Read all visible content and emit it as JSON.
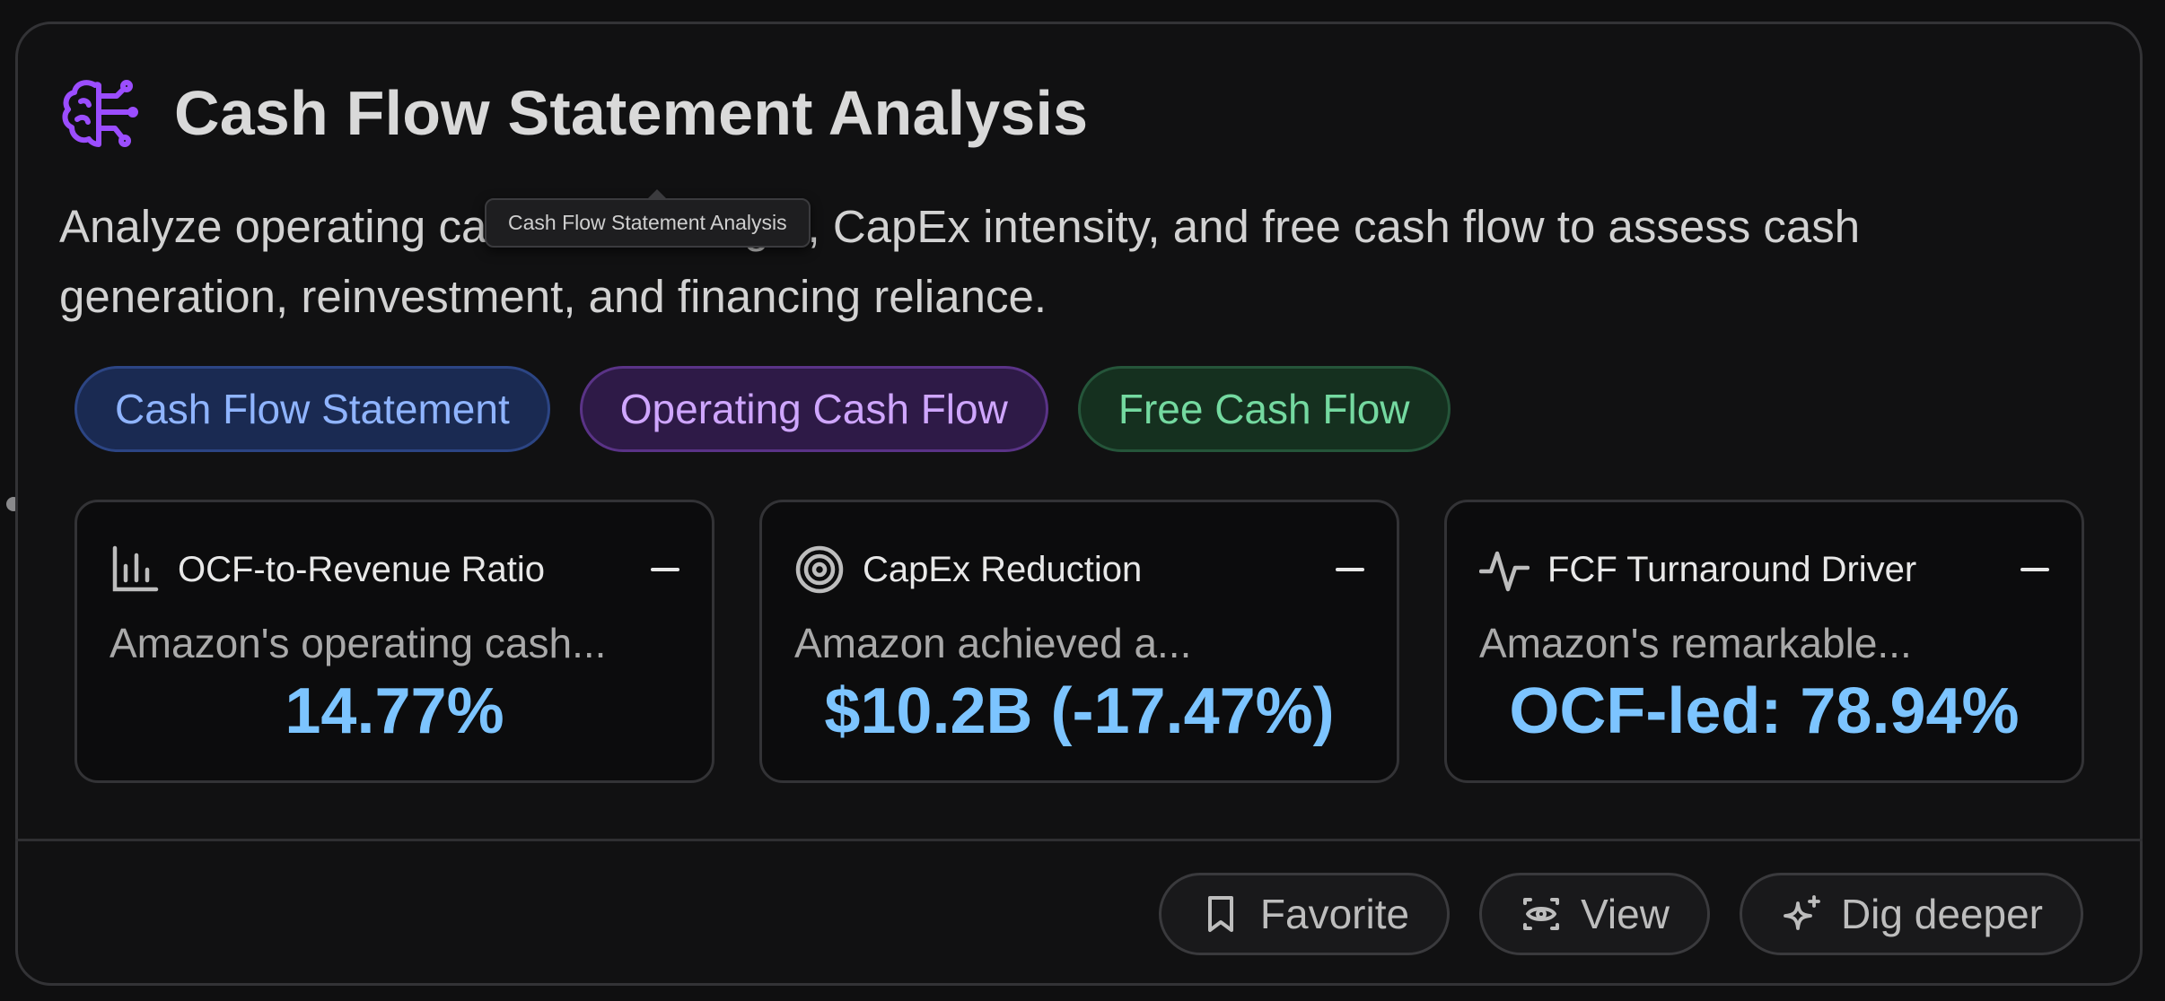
{
  "card": {
    "title": "Cash Flow Statement Analysis",
    "title_icon": "brain-icon",
    "description": "Analyze operating cash flow strength, CapEx intensity, and free cash flow to assess cash generation, reinvestment, and financing reliance.",
    "tooltip": "Cash Flow Statement Analysis"
  },
  "tags": [
    {
      "label": "Cash Flow Statement",
      "color": "#8fb4ff"
    },
    {
      "label": "Operating Cash Flow",
      "color": "#cfa6ff"
    },
    {
      "label": "Free Cash Flow",
      "color": "#74d9a0"
    }
  ],
  "metrics": [
    {
      "icon": "bar-chart-icon",
      "label": "OCF-to-Revenue Ratio",
      "description": "Amazon's operating cash...",
      "value": "14.77%"
    },
    {
      "icon": "target-icon",
      "label": "CapEx Reduction",
      "description": "Amazon achieved a...",
      "value": "$10.2B (-17.47%)"
    },
    {
      "icon": "activity-icon",
      "label": "FCF Turnaround Driver",
      "description": "Amazon's remarkable...",
      "value": "OCF-led: 78.94%"
    }
  ],
  "actions": {
    "favorite": {
      "label": "Favorite",
      "icon": "bookmark-icon"
    },
    "view": {
      "label": "View",
      "icon": "eye-icon"
    },
    "dig_deeper": {
      "label": "Dig deeper",
      "icon": "sparkles-icon"
    }
  },
  "colors": {
    "accent_value": "#7cc4ff",
    "brain_icon": "#9b4dff",
    "background": "#111112"
  }
}
